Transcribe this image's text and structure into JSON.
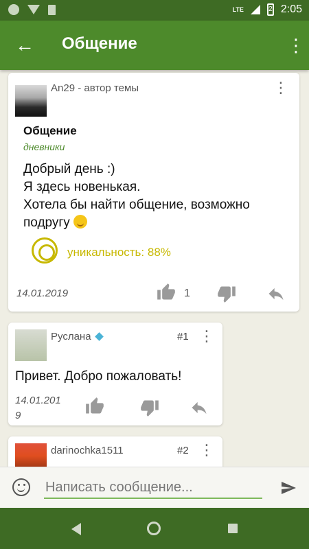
{
  "status_bar": {
    "network": "LTE",
    "battery_level": "2",
    "time": "2:05"
  },
  "app_bar": {
    "title": "Общение"
  },
  "topic": {
    "author": "An29 - автор темы",
    "title": "Общение",
    "category": "дневники",
    "body_lines": [
      "Добрый день :)",
      "Я здесь новенькая.",
      "Хотела бы найти общение, возможно",
      "подругу"
    ],
    "uniqueness": "уникальность: 88%",
    "date": "14.01.2019",
    "likes": "1"
  },
  "replies": [
    {
      "author": "Руслана",
      "number": "#1",
      "text": "Привет. Добро пожаловать!",
      "date_line1": "14.01.201",
      "date_line2": "9"
    },
    {
      "author": "darinochka1511",
      "number": "#2"
    }
  ],
  "composer": {
    "placeholder": "Написать сообщение..."
  },
  "colors": {
    "accent": "#4d8a2b",
    "status_bar": "#3e6b24",
    "uniqueness": "#c7b800"
  }
}
